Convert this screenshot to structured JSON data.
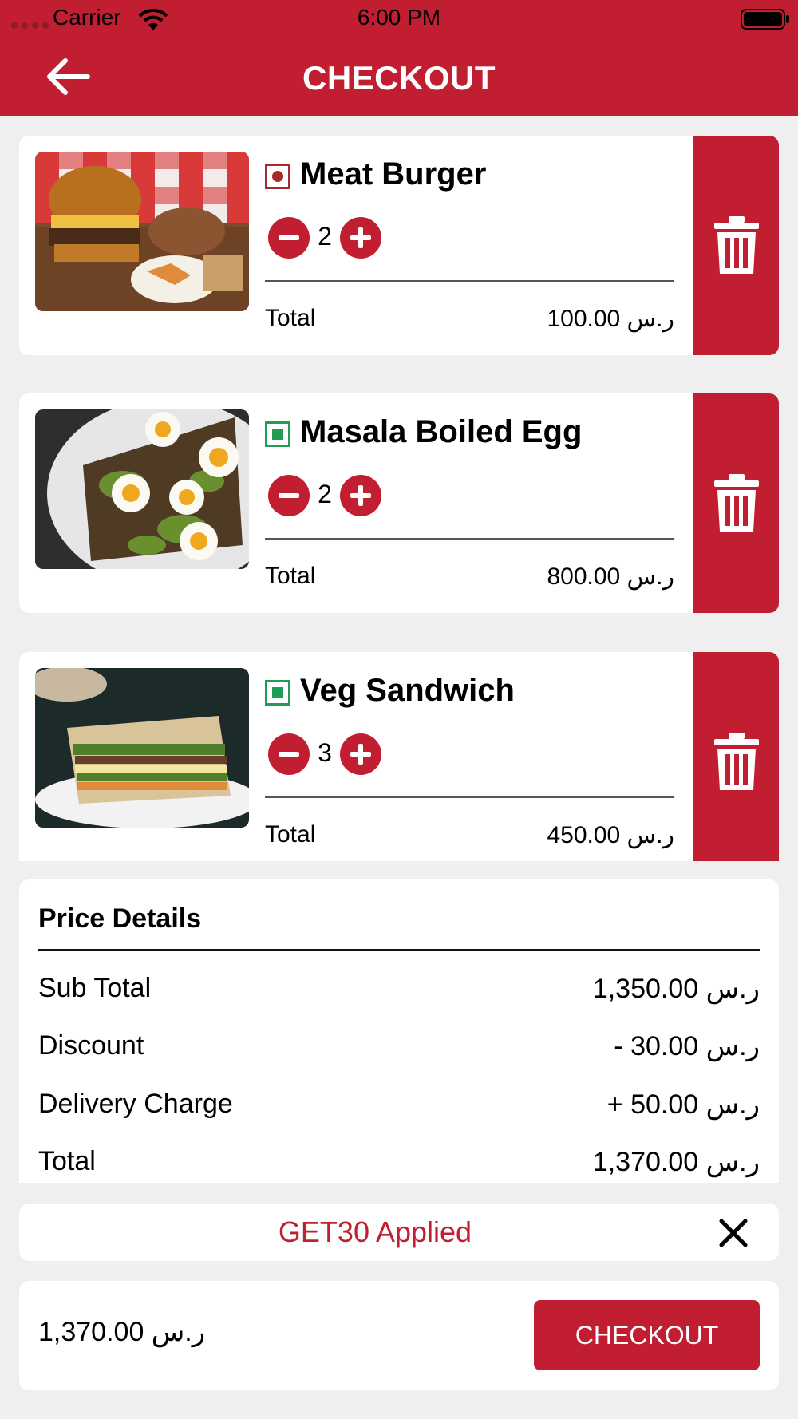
{
  "status_bar": {
    "carrier": "Carrier",
    "time": "6:00 PM"
  },
  "header": {
    "title": "CHECKOUT",
    "back_icon": "arrow-left-icon"
  },
  "cart_items": [
    {
      "name": "Meat Burger",
      "type": "non-veg",
      "quantity": "2",
      "total_label": "Total",
      "total": "100.00 ر.س"
    },
    {
      "name": "Masala Boiled Egg",
      "type": "veg",
      "quantity": "2",
      "total_label": "Total",
      "total": "800.00 ر.س"
    },
    {
      "name": "Veg Sandwich",
      "type": "veg",
      "quantity": "3",
      "total_label": "Total",
      "total": "450.00 ر.س"
    }
  ],
  "price_details": {
    "title": "Price Details",
    "rows": [
      {
        "label": "Sub Total",
        "value": "1,350.00 ر.س"
      },
      {
        "label": "Discount",
        "value": "- ر.س 30.00"
      },
      {
        "label": "Delivery Charge",
        "value": "+ ر.س 50.00"
      },
      {
        "label": "Total",
        "value": "1,370.00 ر.س"
      }
    ]
  },
  "coupon": {
    "text": "GET30 Applied",
    "close_icon": "close-icon"
  },
  "bottom_bar": {
    "total": "1,370.00 ر.س",
    "checkout_label": "CHECKOUT"
  },
  "colors": {
    "primary": "#c11f31",
    "veg": "#1f9d55",
    "non_veg": "#a52a2a",
    "background": "#efefef"
  }
}
